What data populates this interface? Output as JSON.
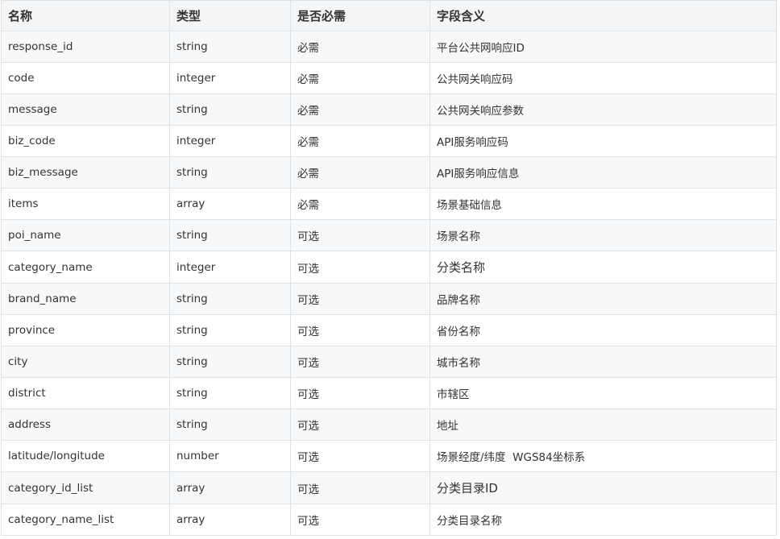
{
  "table": {
    "headers": [
      "名称",
      "类型",
      "是否必需",
      "字段含义"
    ],
    "rows": [
      {
        "name": "response_id",
        "type": "string",
        "required": "必需",
        "meaning": "平台公共网响应ID"
      },
      {
        "name": "code",
        "type": "integer",
        "required": "必需",
        "meaning": "公共网关响应码"
      },
      {
        "name": "message",
        "type": "string",
        "required": "必需",
        "meaning": "公共网关响应参数"
      },
      {
        "name": "biz_code",
        "type": "integer",
        "required": "必需",
        "meaning": "API服务响应码"
      },
      {
        "name": "biz_message",
        "type": "string",
        "required": "必需",
        "meaning": "API服务响应信息"
      },
      {
        "name": "items",
        "type": "array",
        "required": "必需",
        "meaning": "场景基础信息"
      },
      {
        "name": "poi_name",
        "type": "string",
        "required": "可选",
        "meaning": "场景名称"
      },
      {
        "name": "category_name",
        "type": "integer",
        "required": "可选",
        "meaning": "分类名称"
      },
      {
        "name": "brand_name",
        "type": "string",
        "required": "可选",
        "meaning": "品牌名称"
      },
      {
        "name": "province",
        "type": "string",
        "required": "可选",
        "meaning": "省份名称"
      },
      {
        "name": "city",
        "type": "string",
        "required": "可选",
        "meaning": "城市名称"
      },
      {
        "name": "district",
        "type": "string",
        "required": "可选",
        "meaning": "市辖区"
      },
      {
        "name": "address",
        "type": "string",
        "required": "可选",
        "meaning": "地址"
      },
      {
        "name": "latitude/longitude",
        "type": "number",
        "required": "可选",
        "meaning": "场景经度/纬度  WGS84坐标系"
      },
      {
        "name": "category_id_list",
        "type": "array",
        "required": "可选",
        "meaning": "分类目录ID"
      },
      {
        "name": "category_name_list",
        "type": "array",
        "required": "可选",
        "meaning": "分类目录名称"
      }
    ]
  }
}
